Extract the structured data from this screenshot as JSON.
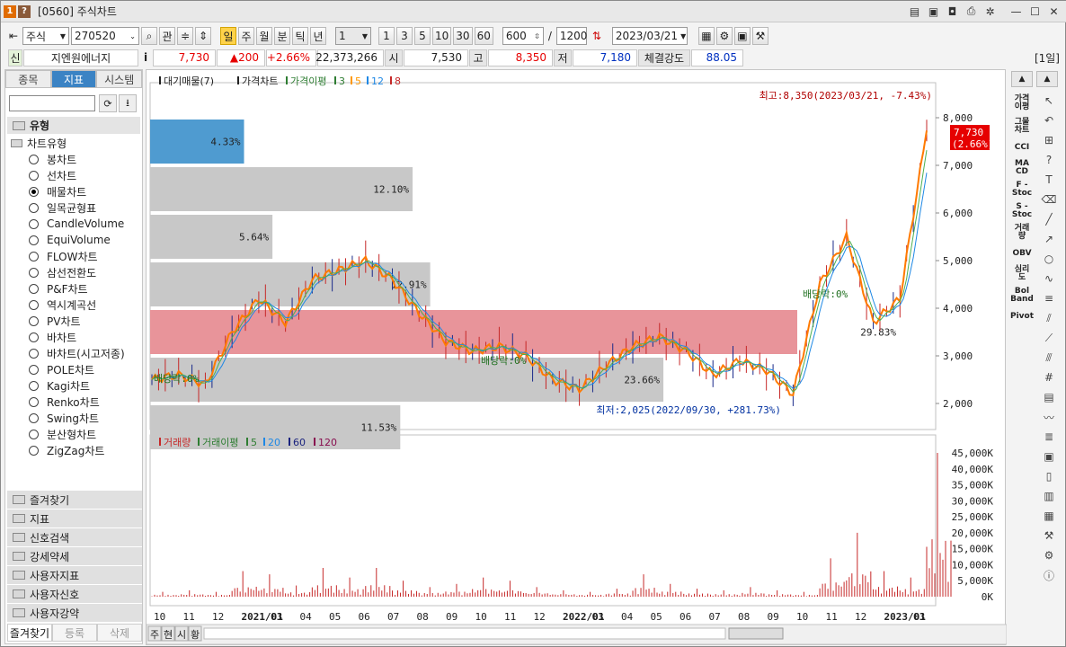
{
  "window": {
    "badge1": "1",
    "badge2": "?",
    "title": "[0560] 주식차트"
  },
  "toolbar": {
    "market": "주식",
    "code": "270520",
    "search_btn": "⌕",
    "gwan": "관",
    "periods": [
      "일",
      "주",
      "월",
      "분",
      "틱",
      "년"
    ],
    "active_period": "일",
    "interval_select": "1",
    "intervals": [
      "1",
      "3",
      "5",
      "10",
      "30",
      "60"
    ],
    "count": "600",
    "slash": "/",
    "max_count": "1200",
    "date": "2023/03/21"
  },
  "infobar": {
    "tag": "신",
    "name": "지엔원에너지",
    "info_icon": "i",
    "price": "7,730",
    "change": "▲200",
    "change_pct": "+2.66%",
    "volume": "22,373,266",
    "open_label": "시",
    "open": "7,530",
    "high_label": "고",
    "high": "8,350",
    "low_label": "저",
    "low": "7,180",
    "strength_label": "체결강도",
    "strength": "88.05",
    "period_tag": "[1일]"
  },
  "left": {
    "tabs": [
      "종목",
      "지표",
      "시스템"
    ],
    "active_tab": "지표",
    "section": "유형",
    "subsection": "차트유형",
    "chart_types": [
      "봉차트",
      "선차트",
      "매물차트",
      "일목균형표",
      "CandleVolume",
      "EquiVolume",
      "FLOW차트",
      "삼선전환도",
      "P&F차트",
      "역시계곡선",
      "PV차트",
      "바차트",
      "바차트(시고저종)",
      "POLE차트",
      "Kagi차트",
      "Renko차트",
      "Swing차트",
      "분산형차트",
      "ZigZag차트"
    ],
    "selected_type": "매물차트",
    "groups": [
      "즐겨찾기",
      "지표",
      "신호검색",
      "강세약세",
      "사용자지표",
      "사용자신호",
      "사용자강약"
    ],
    "bottom": [
      "즐겨찾기",
      "등록",
      "삭제"
    ]
  },
  "chart": {
    "price_legend": {
      "items": [
        "대기매물(7)",
        "가격차트",
        "가격이평",
        "3",
        "5",
        "12",
        "8"
      ]
    },
    "volume_legend": {
      "items": [
        "거래량",
        "거래이평",
        "5",
        "20",
        "60",
        "120"
      ]
    },
    "max_label": "최고:8,350(2023/03/21, -7.43%)",
    "min_label": "최저:2,025(2022/09/30, +281.73%)",
    "current_price": "7,730",
    "current_pct": "(2.66%)",
    "dividend_labels": [
      "배당락:0%",
      "배당락:0%",
      "배당락:0%"
    ],
    "price_ticks": [
      "8,000",
      "7,000",
      "6,000",
      "5,000",
      "4,000",
      "3,000",
      "2,000"
    ],
    "volume_ticks": [
      "45,000K",
      "40,000K",
      "35,000K",
      "30,000K",
      "25,000K",
      "20,000K",
      "15,000K",
      "10,000K",
      "5,000K",
      "0K"
    ],
    "x_ticks": [
      "10",
      "11",
      "12",
      "2021/01",
      "03",
      "04",
      "05",
      "06",
      "07",
      "08",
      "09",
      "10",
      "11",
      "12",
      "2022/01",
      "03",
      "04",
      "05",
      "06",
      "07",
      "08",
      "09",
      "10",
      "11",
      "12",
      "2023/01",
      "03"
    ],
    "bottom_tabs": [
      "주",
      "현",
      "시",
      "황"
    ],
    "colors": {
      "price": "#ff7a00",
      "ma3": "#4caf50",
      "ma5": "#ff9800",
      "ma12": "#1e88e5",
      "ma8": "#c62828",
      "volume": "#c62828",
      "highlight": "#e8949a",
      "blue": "#4f9bd0",
      "gray": "#c8c8c8"
    }
  },
  "chart_data": {
    "type": "bar",
    "title": "",
    "volume_profile": [
      {
        "price_low": 7000,
        "price_high": 8000,
        "pct": 4.33,
        "label": "4.33%"
      },
      {
        "price_low": 6000,
        "price_high": 7000,
        "pct": 12.1,
        "label": "12.10%"
      },
      {
        "price_low": 5000,
        "price_high": 6000,
        "pct": 5.64,
        "label": "5.64%"
      },
      {
        "price_low": 4000,
        "price_high": 5000,
        "pct": 12.91,
        "label": "12.91%"
      },
      {
        "price_low": 3000,
        "price_high": 4000,
        "pct": 29.83,
        "label": "29.83%"
      },
      {
        "price_low": 2000,
        "price_high": 3000,
        "pct": 23.66,
        "label": "23.66%"
      },
      {
        "price_low": 1000,
        "price_high": 2000,
        "pct": 11.53,
        "label": "11.53%"
      }
    ],
    "price_series": {
      "x": [
        "2020/10",
        "2020/11",
        "2020/12",
        "2021/01",
        "2021/02",
        "2021/03",
        "2021/04",
        "2021/05",
        "2021/06",
        "2021/07",
        "2021/08",
        "2021/09",
        "2021/10",
        "2021/11",
        "2021/12",
        "2022/01",
        "2022/02",
        "2022/03",
        "2022/04",
        "2022/05",
        "2022/06",
        "2022/07",
        "2022/08",
        "2022/09",
        "2022/10",
        "2022/11",
        "2022/12",
        "2023/01",
        "2023/02",
        "2023/03"
      ],
      "close": [
        2500,
        2600,
        2400,
        3500,
        4200,
        3700,
        4600,
        4800,
        5000,
        4600,
        3900,
        3300,
        3100,
        3200,
        3000,
        2500,
        2300,
        2800,
        3200,
        3400,
        3100,
        2600,
        2900,
        2700,
        2200,
        4500,
        5500,
        3700,
        4200,
        7730
      ]
    },
    "volume_k": [
      1500,
      2000,
      1500,
      8000,
      7000,
      3500,
      9000,
      6000,
      9000,
      5000,
      3000,
      4000,
      6000,
      5000,
      3000,
      2000,
      1500,
      2500,
      7000,
      4000,
      2500,
      2000,
      3000,
      2000,
      1500,
      12000,
      20000,
      8000,
      6000,
      45000
    ],
    "ylim": [
      2000,
      8350
    ],
    "volume_ylim": [
      0,
      45000
    ]
  }
}
